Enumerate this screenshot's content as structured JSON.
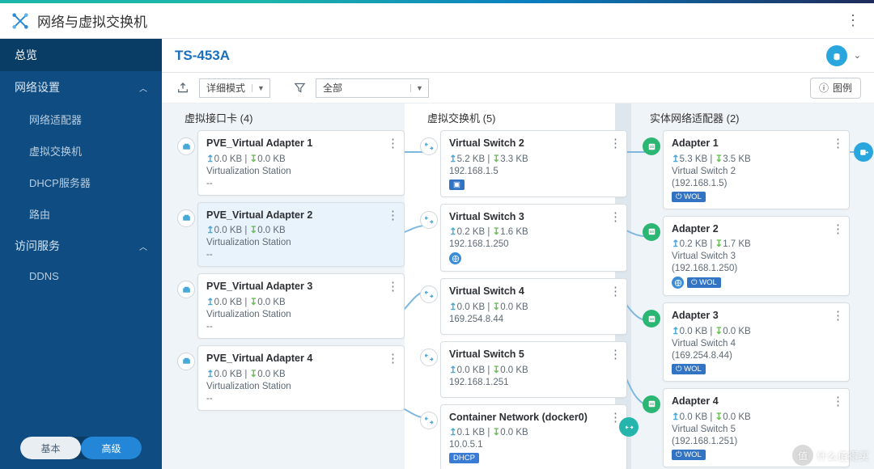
{
  "app": {
    "title": "网络与虚拟交换机"
  },
  "header": {
    "device": "TS-453A"
  },
  "toolbar": {
    "mode_label": "详细模式",
    "filter_label": "全部",
    "legend_label": "图例"
  },
  "sidebar": {
    "overview": "总览",
    "net_settings": "网络设置",
    "adapters": "网络适配器",
    "vswitch": "虚拟交换机",
    "dhcp": "DHCP服务器",
    "route": "路由",
    "access": "访问服务",
    "ddns": "DDNS",
    "basic": "基本",
    "advanced": "高级"
  },
  "columns": {
    "va": "虚拟接口卡 (4)",
    "vs": "虚拟交换机 (5)",
    "ad": "实体网络适配器 (2)"
  },
  "va": [
    {
      "name": "PVE_Virtual Adapter 1",
      "up": "0.0 KB",
      "down": "0.0 KB",
      "sub": "Virtualization Station",
      "sub2": "--"
    },
    {
      "name": "PVE_Virtual Adapter 2",
      "up": "0.0 KB",
      "down": "0.0 KB",
      "sub": "Virtualization Station",
      "sub2": "--"
    },
    {
      "name": "PVE_Virtual Adapter 3",
      "up": "0.0 KB",
      "down": "0.0 KB",
      "sub": "Virtualization Station",
      "sub2": "--"
    },
    {
      "name": "PVE_Virtual Adapter 4",
      "up": "0.0 KB",
      "down": "0.0 KB",
      "sub": "Virtualization Station",
      "sub2": "--"
    }
  ],
  "vs": [
    {
      "name": "Virtual Switch 2",
      "up": "5.2 KB",
      "down": "3.3 KB",
      "ip": "192.168.1.5",
      "badge": "nat"
    },
    {
      "name": "Virtual Switch 3",
      "up": "0.2 KB",
      "down": "1.6 KB",
      "ip": "192.168.1.250",
      "badge": "globe"
    },
    {
      "name": "Virtual Switch 4",
      "up": "0.0 KB",
      "down": "0.0 KB",
      "ip": "169.254.8.44",
      "badge": ""
    },
    {
      "name": "Virtual Switch 5",
      "up": "0.0 KB",
      "down": "0.0 KB",
      "ip": "192.168.1.251",
      "badge": ""
    },
    {
      "name": "Container Network (docker0)",
      "up": "0.1 KB",
      "down": "0.0 KB",
      "ip": "10.0.5.1",
      "badge": "dhcp"
    }
  ],
  "ad": [
    {
      "name": "Adapter 1",
      "up": "5.3 KB",
      "down": "3.5 KB",
      "sub": "Virtual Switch 2",
      "ip": "(192.168.1.5)",
      "wol": "WOL"
    },
    {
      "name": "Adapter 2",
      "up": "0.2 KB",
      "down": "1.7 KB",
      "sub": "Virtual Switch 3",
      "ip": "(192.168.1.250)",
      "wol": "WOL",
      "globe": true
    },
    {
      "name": "Adapter 3",
      "up": "0.0 KB",
      "down": "0.0 KB",
      "sub": "Virtual Switch 4",
      "ip": "(169.254.8.44)",
      "wol": "WOL"
    },
    {
      "name": "Adapter 4",
      "up": "0.0 KB",
      "down": "0.0 KB",
      "sub": "Virtual Switch 5",
      "ip": "(192.168.1.251)",
      "wol": "WOL"
    }
  ],
  "labels": {
    "dhcp": "DHCP",
    "wol_prefix": "⏻"
  },
  "watermark": {
    "zhi": "值",
    "text": "什么值得买"
  }
}
